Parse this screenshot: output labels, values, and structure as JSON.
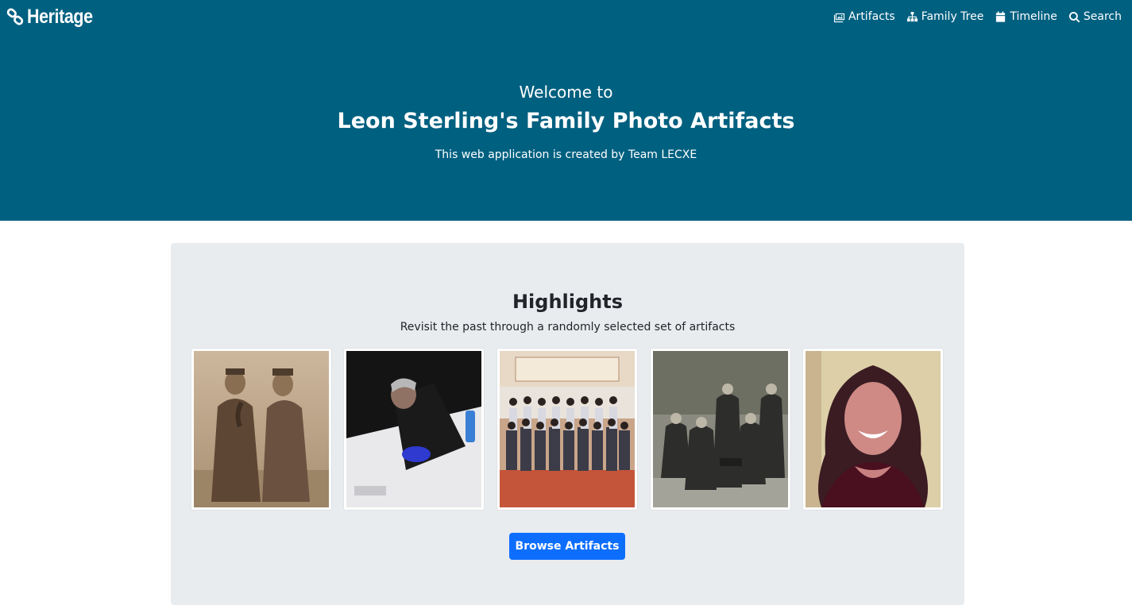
{
  "navbar": {
    "brand_name": "Heritage",
    "brand_icon": "link-icon",
    "items": [
      {
        "label": "Artifacts",
        "icon": "images-icon"
      },
      {
        "label": "Family Tree",
        "icon": "sitemap-icon"
      },
      {
        "label": "Timeline",
        "icon": "calendar-icon"
      },
      {
        "label": "Search",
        "icon": "search-icon"
      }
    ]
  },
  "hero": {
    "welcome": "Welcome to",
    "title": "Leon Sterling's Family Photo Artifacts",
    "subtitle": "This web application is created by Team LECXE",
    "background_color": "#006080"
  },
  "highlights": {
    "title": "Highlights",
    "subtitle": "Revisit the past through a randomly selected set of artifacts",
    "photos": [
      {
        "name": "two-men-sepia-photo"
      },
      {
        "name": "man-signing-document-photo"
      },
      {
        "name": "group-photo-conference"
      },
      {
        "name": "family-group-bw-photo"
      },
      {
        "name": "smiling-woman-portrait-photo"
      }
    ],
    "button_label": "Browse Artifacts",
    "button_color": "#0d6efd",
    "panel_color": "#e9ecef"
  }
}
